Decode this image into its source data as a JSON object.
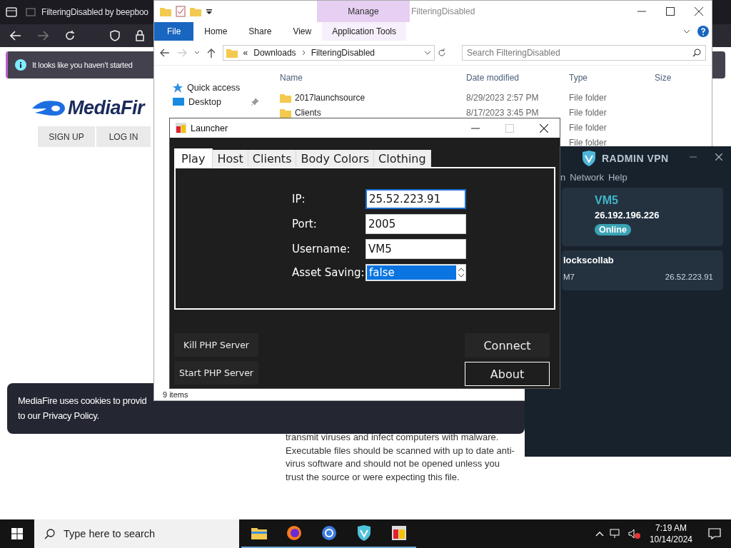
{
  "browser": {
    "tab_title": "FilteringDisabled by beepboo",
    "notice": "It looks like you haven’t started",
    "logo": "MediaFir",
    "nav_buttons": [
      "SIGN UP",
      "LOG IN"
    ],
    "warning": "transmit viruses and infect computers with malware. Executable files should be scanned with up to date anti-virus software and should not be opened unless you trust the source or were expecting this file.",
    "cookie": {
      "line_1": "MediaFire uses cookies to provid",
      "line_2": "to our Privacy Policy."
    }
  },
  "explorer": {
    "title": "FilteringDisabled",
    "contextual_tab": "Manage",
    "ribbon_tabs": [
      {
        "label": "File",
        "kind": "file"
      },
      {
        "label": "Home",
        "kind": "tab"
      },
      {
        "label": "Share",
        "kind": "tab"
      },
      {
        "label": "View",
        "kind": "tab"
      },
      {
        "label": "Application Tools",
        "kind": "contextual"
      }
    ],
    "address": {
      "overflow": "«",
      "path": [
        "Downloads",
        "FilteringDisabled"
      ]
    },
    "search": {
      "placeholder": "Search FilteringDisabled"
    },
    "nav_items": [
      {
        "label": "Quick access",
        "kind": "star",
        "pinned": false
      },
      {
        "label": "Desktop",
        "kind": "desktop",
        "pinned": true
      }
    ],
    "columns": [
      "Name",
      "Date modified",
      "Type",
      "Size"
    ],
    "rows": [
      {
        "name": "2017launchsource",
        "date": "8/29/2023 2:57 PM",
        "type": "File folder"
      },
      {
        "name": "Clients",
        "date": "8/17/2023 3:45 PM",
        "type": "File folder"
      },
      {
        "type": "File folder"
      },
      {
        "type": "File folder"
      }
    ],
    "status_bar": "9 items"
  },
  "launcher": {
    "title": "Launcher",
    "tabs": [
      {
        "label": "Play",
        "selected": true
      },
      {
        "label": "Host",
        "selected": false
      },
      {
        "label": "Clients",
        "selected": false
      },
      {
        "label": "Body Colors",
        "selected": false
      },
      {
        "label": "Clothing",
        "selected": false
      }
    ],
    "fields": [
      {
        "label": "IP:",
        "value": "25.52.223.91",
        "kind": "text",
        "focused": true
      },
      {
        "label": "Port:",
        "value": "2005",
        "kind": "text",
        "focused": false
      },
      {
        "label": "Username:",
        "value": "VM5",
        "kind": "text",
        "focused": false
      },
      {
        "label": "Asset Saving:",
        "value": "false",
        "kind": "spinner",
        "focused": false
      }
    ],
    "left_buttons": [
      {
        "label": "Kill PHP Server",
        "focused": false
      },
      {
        "label": "Start PHP Server",
        "focused": false
      }
    ],
    "right_buttons": [
      {
        "label": "Connect",
        "focused": false
      },
      {
        "label": "About",
        "focused": true
      }
    ]
  },
  "radmin": {
    "title": "RADMIN VPN",
    "menu": [
      "n",
      "Network",
      "Help"
    ],
    "profile": {
      "name": "VM5",
      "ip": "26.192.196.226",
      "status": "Online"
    },
    "network": {
      "name": "lockscollab",
      "members": [
        {
          "name": "M7",
          "ip": "26.52.223.91"
        }
      ]
    }
  },
  "taskbar": {
    "search_placeholder": "Type here to search",
    "apps": [
      {
        "kind": "folder"
      },
      {
        "kind": "firefox"
      },
      {
        "kind": "chrome"
      },
      {
        "kind": "vpn"
      },
      {
        "kind": "launcher"
      }
    ],
    "time": "7:19 AM",
    "date": "10/14/2024"
  }
}
